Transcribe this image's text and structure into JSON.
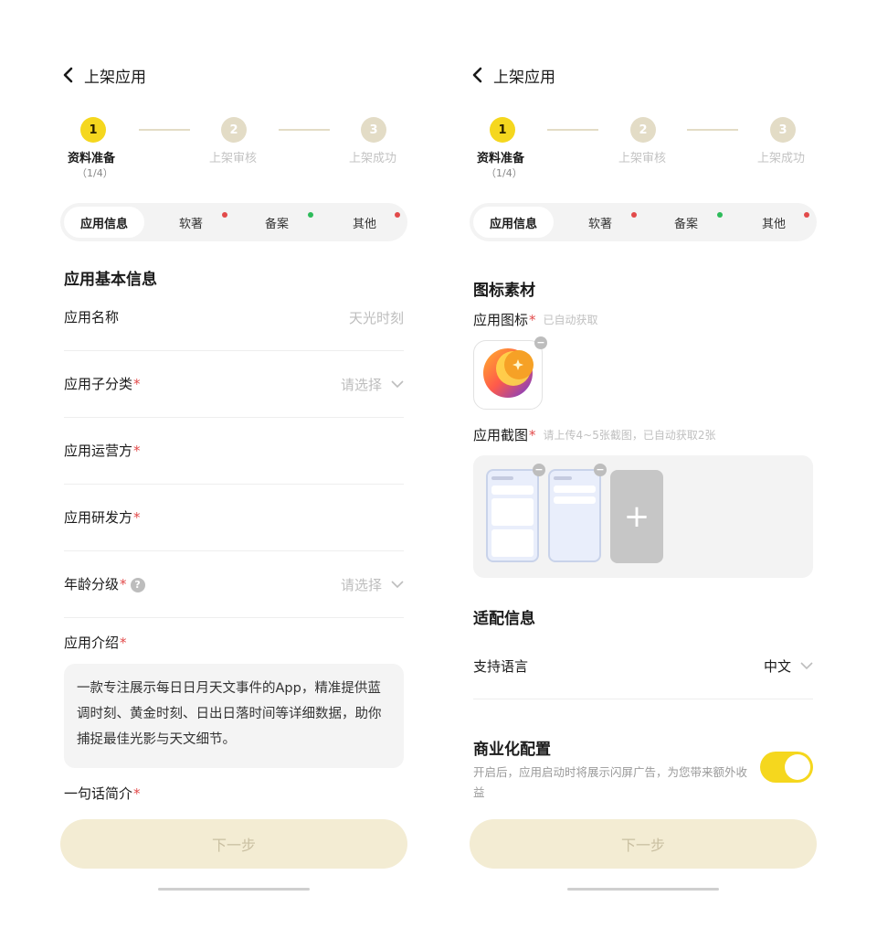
{
  "header": {
    "title": "上架应用"
  },
  "steps": [
    {
      "num": "1",
      "label": "资料准备",
      "sub": "（1/4）"
    },
    {
      "num": "2",
      "label": "上架审核"
    },
    {
      "num": "3",
      "label": "上架成功"
    }
  ],
  "tabs": [
    {
      "label": "应用信息",
      "dot": ""
    },
    {
      "label": "软著",
      "dot": "#e24a4a"
    },
    {
      "label": "备案",
      "dot": "#2dbb5a"
    },
    {
      "label": "其他",
      "dot": "#e24a4a"
    }
  ],
  "left": {
    "section_title": "应用基本信息",
    "fields": {
      "name": {
        "label": "应用名称",
        "value": "天光时刻"
      },
      "category": {
        "label": "应用子分类",
        "req": "*",
        "value": "请选择"
      },
      "operator": {
        "label": "应用运营方",
        "req": "*"
      },
      "developer": {
        "label": "应用研发方",
        "req": "*"
      },
      "age": {
        "label": "年龄分级",
        "req": "*",
        "value": "请选择",
        "help": "?"
      },
      "intro": {
        "label": "应用介绍",
        "req": "*",
        "value": "一款专注展示每日日月天文事件的App，精准提供蓝调时刻、黄金时刻、日出日落时间等详细数据，助你捕捉最佳光影与天文细节。"
      },
      "slogan": {
        "label": "一句话简介",
        "req": "*"
      }
    },
    "next_label": "下一步"
  },
  "right": {
    "section_icons": "图标素材",
    "icon_field": {
      "label": "应用图标",
      "req": "*",
      "hint": "已自动获取"
    },
    "shots_field": {
      "label": "应用截图",
      "req": "*",
      "hint": "请上传4~5张截图，已自动获取2张"
    },
    "add_symbol": "+",
    "remove_symbol": "−",
    "section_adapt": "适配信息",
    "lang": {
      "label": "支持语言",
      "value": "中文"
    },
    "biz_title": "商业化配置",
    "biz_desc": "开启后，应用启动时将展示闪屏广告，为您带来额外收益",
    "biz_enabled": true,
    "next_label": "下一步"
  },
  "colors": {
    "accent": "#f5d71e",
    "required": "#e24a4a",
    "button_bg": "#f3ecd3"
  }
}
